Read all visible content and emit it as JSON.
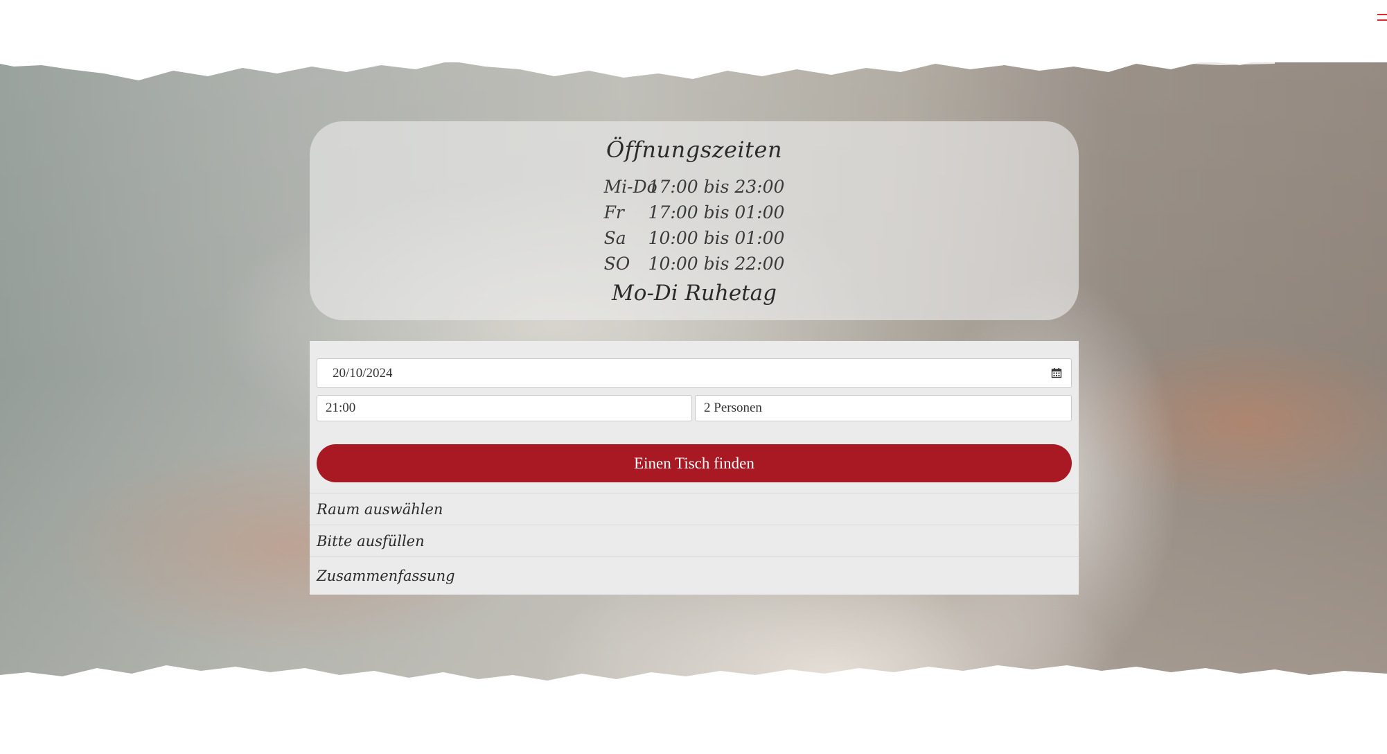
{
  "opening_hours": {
    "title": "Öffnungszeiten",
    "rows": [
      {
        "day": "Mi-Do",
        "time": "17:00 bis 23:00"
      },
      {
        "day": "Fr",
        "time": "17:00 bis 01:00"
      },
      {
        "day": "Sa",
        "time": "10:00 bis 01:00"
      },
      {
        "day": "SO",
        "time": "10:00 bis 22:00"
      }
    ],
    "closed_note": "Mo-Di Ruhetag"
  },
  "booking": {
    "date_value": "20/10/2024",
    "time_value": "21:00",
    "persons_value": "2 Personen",
    "find_button_label": "Einen Tisch finden",
    "steps": [
      "Raum auswählen",
      "Bitte ausfüllen",
      "Zusammenfassung"
    ]
  },
  "icons": {
    "menu": "hamburger-menu-icon",
    "calendar": "calendar-icon"
  },
  "colors": {
    "accent": "#a81923",
    "menu_icon": "#e02a2a",
    "form_background": "#ebebeb"
  }
}
